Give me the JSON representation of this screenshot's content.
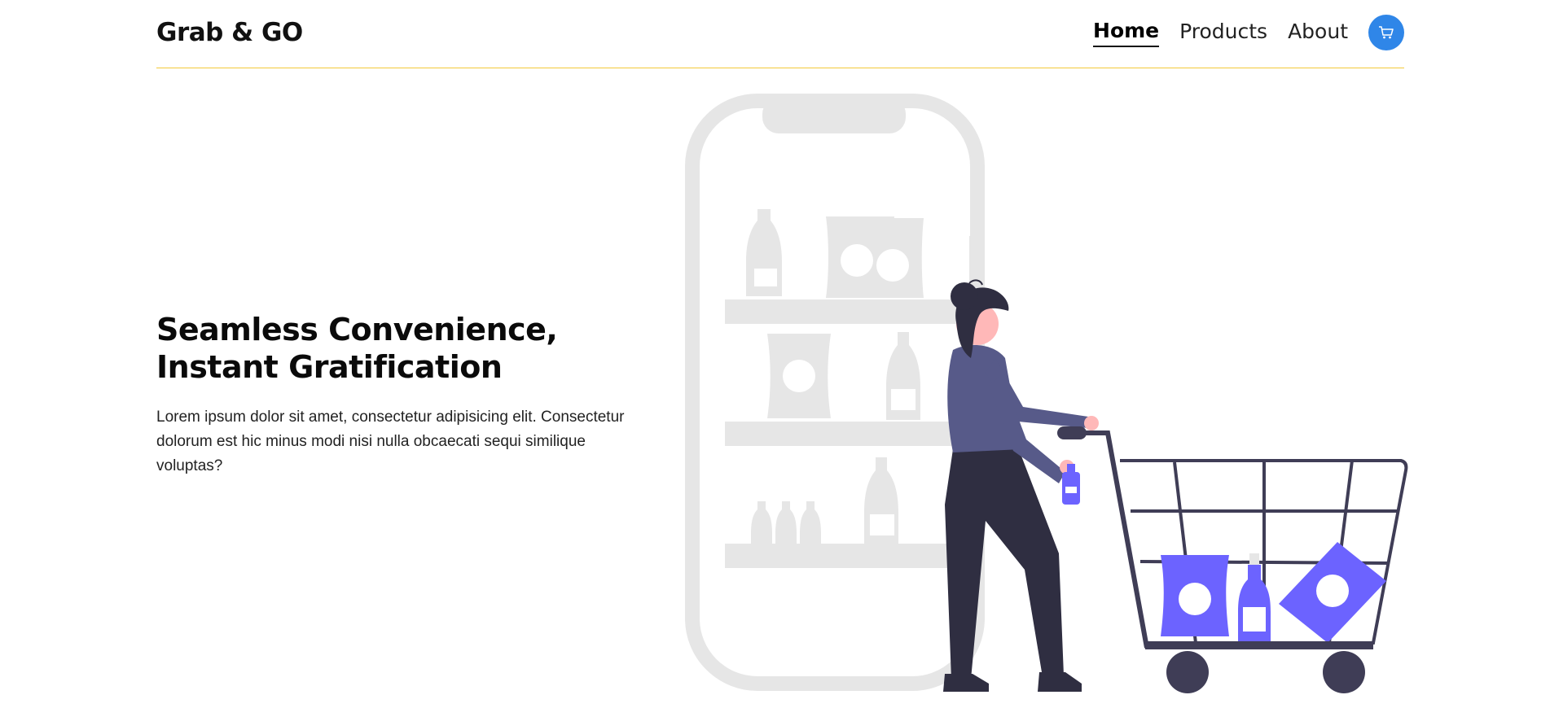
{
  "header": {
    "brand": "Grab & GO",
    "nav": [
      {
        "label": "Home",
        "active": true
      },
      {
        "label": "Products",
        "active": false
      },
      {
        "label": "About",
        "active": false
      }
    ],
    "cart_icon": "cart-icon",
    "accent_color": "#f3c93a",
    "cart_button_color": "#2f86e8"
  },
  "hero": {
    "title_line1": "Seamless Convenience,",
    "title_line2": "Instant Gratification",
    "description": "Lorem ipsum dolor sit amet, consectetur adipisicing elit. Consectetur dolorum est hic minus modi nisi nulla obcaecati sequi similique voluptas?"
  },
  "illustration": {
    "subject": "woman pushing shopping cart beside phone with shelves",
    "product_color": "#6c63ff",
    "outline_color": "#e6e6e6",
    "figure_dark": "#2f2e41",
    "shirt_color": "#575a89"
  }
}
